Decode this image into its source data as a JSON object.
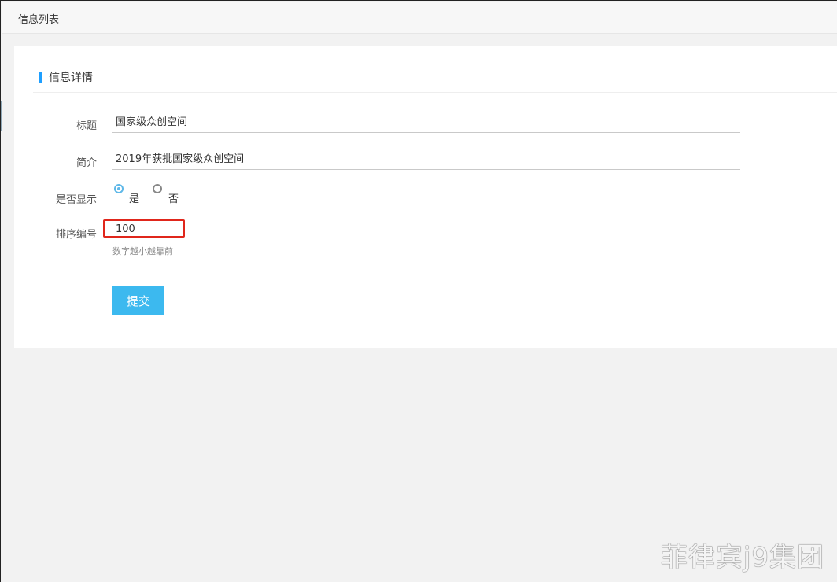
{
  "topbar": {
    "title": "信息列表"
  },
  "panel": {
    "title": "信息详情",
    "accent_color": "#1e9fff"
  },
  "form": {
    "title_label": "标题",
    "title_value": "国家级众创空间",
    "intro_label": "简介",
    "intro_value": "2019年获批国家级众创空间",
    "display_label": "是否显示",
    "display_options": [
      {
        "label": "是",
        "checked": true
      },
      {
        "label": "否",
        "checked": false
      }
    ],
    "sort_label": "排序编号",
    "sort_value": "100",
    "sort_hint": "数字越小越靠前",
    "submit_label": "提交",
    "submit_color": "#3cb9ef",
    "highlight_color": "#e0261b"
  },
  "watermark": {
    "text": "菲律宾j9集团"
  }
}
